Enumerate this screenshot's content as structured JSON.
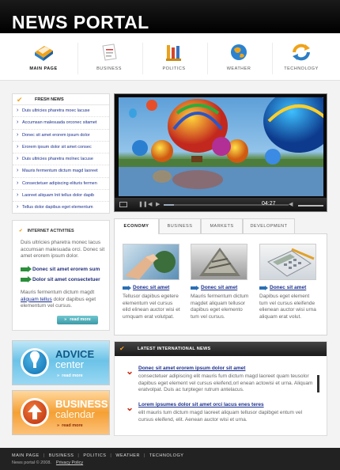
{
  "header": {
    "logo": "NEWS PORTAL"
  },
  "nav": {
    "items": [
      {
        "label": "MAIN PAGE",
        "icon": "book-icon"
      },
      {
        "label": "BUSINESS",
        "icon": "document-icon"
      },
      {
        "label": "POLITICS",
        "icon": "flags-icon"
      },
      {
        "label": "WEATHER",
        "icon": "globe-icon"
      },
      {
        "label": "TECHNOLOGY",
        "icon": "refresh-icon"
      }
    ]
  },
  "fresh_news": {
    "title": "FRESH NEWS",
    "items": [
      "Duis ultricies pharetra moec lacuse",
      "Accumsan malesuada orconec sitamet",
      "Donec sit amet erorem ipsum dolor",
      "Erorem ipsum dolor sit amet consec",
      "Duis ultricies pharetra molnec lacuse",
      "Mauris fermentum dictum magd laoreet",
      "Consectetuer adipiscing elituris fermen",
      "Laoreet aliquam lnit tellus dolor dapib",
      "Tellus dolor dapibus eget elementum"
    ]
  },
  "activities": {
    "title": "INTERNET ACTIVITIES",
    "para1": "Duis ultricies pharetra monec lacus accumsan malesuada orci. Donec sit amet erorem ipsum dolor.",
    "link1": "Donec sit amet erorem sum",
    "link2": "Dolor sit amet consectetuer",
    "para2_pre": "Mauris fermentum dictum magdt ",
    "para2_link": "aliquam tellus",
    "para2_post": " dolor dapibus eget elementum vel cursus.",
    "more": "read more"
  },
  "video": {
    "time": "04:27"
  },
  "tabs": [
    "ECONOMY",
    "BUSINESS",
    "MARKETS",
    "DEVELOPMENT"
  ],
  "cards": [
    {
      "link": "Donec sit amet",
      "text": "Tellusor dapibus egetere elementum vel cursus eild elinean auctor wisi et urnquam erat volutpat."
    },
    {
      "link": "Donec sit amet",
      "text": "Mauris fermentum dictum magdet aliquam tellusor dapibus eget elemento tum vel cursus."
    },
    {
      "link": "Donec sit amet",
      "text": "Dapibus eget element tum vel cursus eleifende elienean auctor wisi urna aliquam erat volut."
    }
  ],
  "intl": {
    "title": "LATEST INTERNATIONAL NEWS",
    "items": [
      {
        "title": "Donec sit amet erorem ipsum dolor sit amet",
        "body": "consectetuer adipiscing elit mauris fum dictum magd laoreet quam teusolor dapibus eget element vel cursus eleifend,orl enean actowisi et urna. Aliquam eratvolpat. Duis ac turpteger rutrum antelacus."
      },
      {
        "title": "Lorem ipsumes dolor sit amet orci lacus enes teres",
        "body": "elit mauris tum dictum magd laoreet aliquam tellusor dapibget entum vel cursus eleifend, elit. Aenean auctor wisi et urna."
      }
    ]
  },
  "footer": {
    "nav": [
      "MAIN PAGE",
      "BUSINESS",
      "POLITICS",
      "WEATHER",
      "TECHNOLOGY"
    ],
    "copyright": "News portal © 2008.",
    "privacy": "Privacy Policy"
  },
  "colors": {
    "accent": "#f3a21a",
    "link": "#1a2f8c",
    "green_arrow": "#2b8f3b",
    "red_chevron": "#cc2c12"
  }
}
